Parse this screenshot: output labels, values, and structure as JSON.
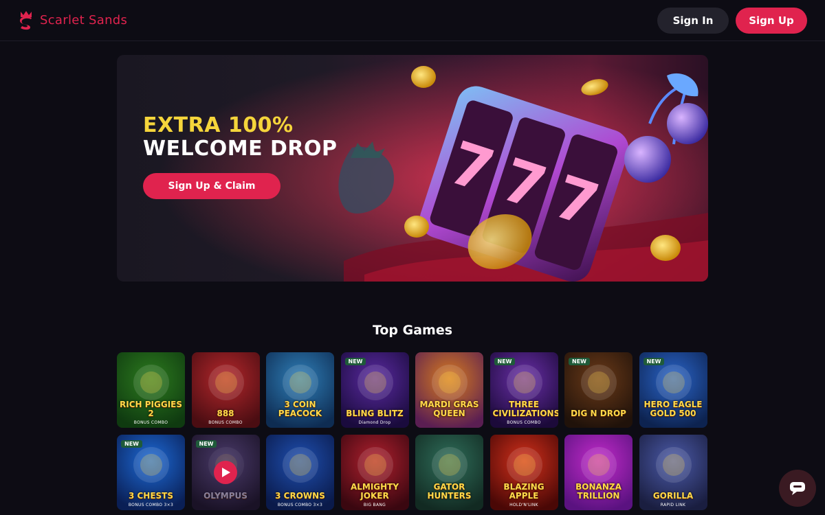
{
  "brand": {
    "name": "Scarlet Sands",
    "logo_icon": "flame-s-logo-icon",
    "color": "#e0234e"
  },
  "header": {
    "signin_label": "Sign In",
    "signup_label": "Sign Up"
  },
  "hero": {
    "line1": "EXTRA 100%",
    "line2": "WELCOME DROP",
    "cta_label": "Sign Up & Claim",
    "accent": "#f5d53b"
  },
  "top_games": {
    "title": "Top Games",
    "games": [
      {
        "title": "RICH PIGGIES 2",
        "sub": "BONUS COMBO",
        "badge": "",
        "bg1": "#2c7a1e",
        "bg2": "#0f3a10"
      },
      {
        "title": "888",
        "sub": "BONUS COMBO",
        "badge": "",
        "bg1": "#b4272b",
        "bg2": "#4a0d12"
      },
      {
        "title": "3 COIN PEACOCK",
        "sub": "",
        "badge": "",
        "bg1": "#2f7fb8",
        "bg2": "#0e2c52"
      },
      {
        "title": "BLING BLITZ",
        "sub": "Diamond Drop",
        "badge": "NEW",
        "bg1": "#5a2aa0",
        "bg2": "#1a0b3d"
      },
      {
        "title": "MARDI GRAS QUEEN",
        "sub": "",
        "badge": "",
        "bg1": "#d77b1f",
        "bg2": "#5a1e52"
      },
      {
        "title": "THREE CIVILIZATIONS",
        "sub": "BONUS COMBO",
        "badge": "NEW",
        "bg1": "#6a2fa8",
        "bg2": "#1c0a3a"
      },
      {
        "title": "DIG N DROP",
        "sub": "",
        "badge": "NEW",
        "bg1": "#6b3a18",
        "bg2": "#20120a"
      },
      {
        "title": "HERO EAGLE GOLD 500",
        "sub": "",
        "badge": "NEW",
        "bg1": "#2a64c8",
        "bg2": "#0d2350"
      },
      {
        "title": "3 CHESTS",
        "sub": "BONUS COMBO 3×3",
        "badge": "NEW",
        "bg1": "#1d6ad6",
        "bg2": "#0a1f55"
      },
      {
        "title": "OLYMPUS",
        "sub": "",
        "badge": "NEW",
        "bg1": "#4a3a6a",
        "bg2": "#1a1226"
      },
      {
        "title": "3 CROWNS",
        "sub": "BONUS COMBO 3×3",
        "badge": "",
        "bg1": "#1f4fb0",
        "bg2": "#0a1a4a"
      },
      {
        "title": "ALMIGHTY JOKER",
        "sub": "BIG BANG",
        "badge": "",
        "bg1": "#b0202e",
        "bg2": "#3a0710"
      },
      {
        "title": "GATOR HUNTERS",
        "sub": "",
        "badge": "",
        "bg1": "#2f6e5a",
        "bg2": "#122a22"
      },
      {
        "title": "BLAZING APPLE",
        "sub": "HOLD'N'LINK",
        "badge": "",
        "bg1": "#d2301b",
        "bg2": "#4a0806"
      },
      {
        "title": "BONANZA TRILLION",
        "sub": "",
        "badge": "",
        "bg1": "#c22bc9",
        "bg2": "#5a1280"
      },
      {
        "title": "GORILLA",
        "sub": "RAPID LINK",
        "badge": "",
        "bg1": "#4b5aa8",
        "bg2": "#1a1e40"
      }
    ]
  },
  "chat": {
    "icon": "chat-bubble-icon"
  }
}
